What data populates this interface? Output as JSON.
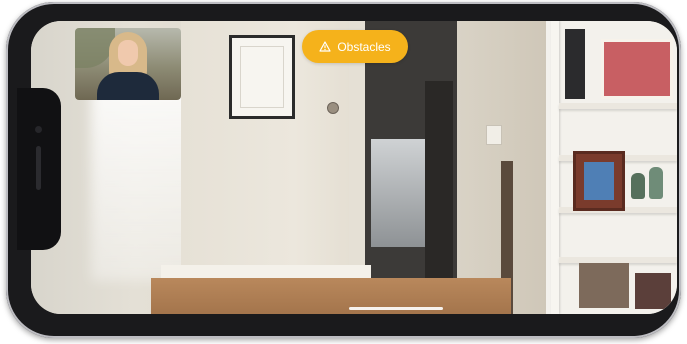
{
  "screen": {
    "obstacle_button": {
      "label": "Obstacles",
      "icon": "warning-triangle-icon",
      "color": "#f5b21b"
    },
    "caller_video": {
      "description_icon": "video-feed"
    }
  },
  "colors": {
    "device_frame": "#1a1a1c",
    "accent": "#f5b21b"
  }
}
